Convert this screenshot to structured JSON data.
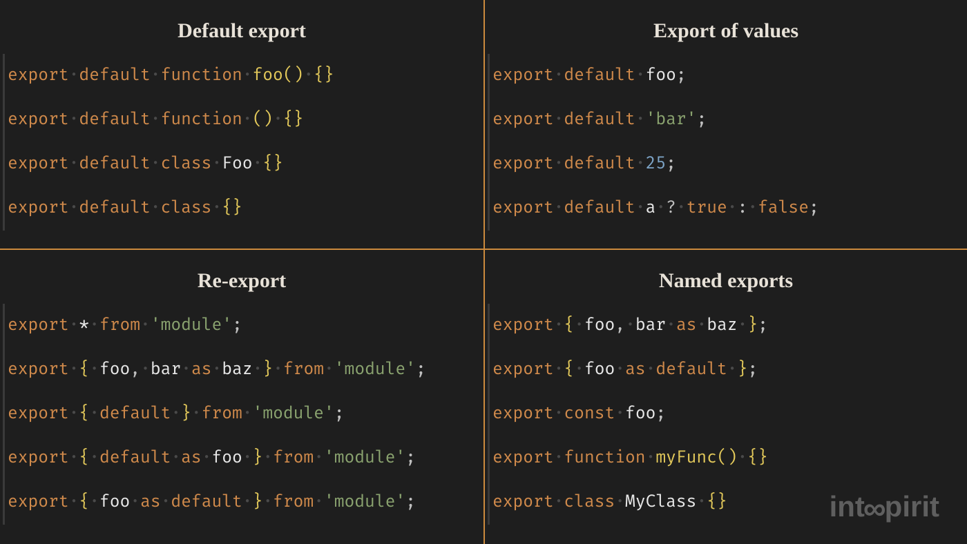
{
  "colors": {
    "divider": "#cc8a3d",
    "bg": "#1e1e1e"
  },
  "logo": {
    "left": "int",
    "symbol": "∞",
    "right": "pirit"
  },
  "quadrants": [
    {
      "id": "default-export",
      "title": "Default export",
      "lines": [
        [
          {
            "t": "export",
            "c": "kw"
          },
          "·",
          {
            "t": "default",
            "c": "kw"
          },
          "·",
          {
            "t": "function",
            "c": "kw"
          },
          "·",
          {
            "t": "foo",
            "c": "fn"
          },
          {
            "t": "()",
            "c": "br"
          },
          "·",
          {
            "t": "{}",
            "c": "br"
          }
        ],
        [
          {
            "t": "export",
            "c": "kw"
          },
          "·",
          {
            "t": "default",
            "c": "kw"
          },
          "·",
          {
            "t": "function",
            "c": "kw"
          },
          "·",
          {
            "t": "()",
            "c": "br"
          },
          "·",
          {
            "t": "{}",
            "c": "br"
          }
        ],
        [
          {
            "t": "export",
            "c": "kw"
          },
          "·",
          {
            "t": "default",
            "c": "kw"
          },
          "·",
          {
            "t": "class",
            "c": "kw"
          },
          "·",
          {
            "t": "Foo",
            "c": "id"
          },
          "·",
          {
            "t": "{}",
            "c": "br"
          }
        ],
        [
          {
            "t": "export",
            "c": "kw"
          },
          "·",
          {
            "t": "default",
            "c": "kw"
          },
          "·",
          {
            "t": "class",
            "c": "kw"
          },
          "·",
          {
            "t": "{}",
            "c": "br"
          }
        ]
      ]
    },
    {
      "id": "export-of-values",
      "title": "Export of values",
      "lines": [
        [
          {
            "t": "export",
            "c": "kw"
          },
          "·",
          {
            "t": "default",
            "c": "kw"
          },
          "·",
          {
            "t": "foo",
            "c": "id"
          },
          {
            "t": ";",
            "c": "pn"
          }
        ],
        [
          {
            "t": "export",
            "c": "kw"
          },
          "·",
          {
            "t": "default",
            "c": "kw"
          },
          "·",
          {
            "t": "'bar'",
            "c": "str"
          },
          {
            "t": ";",
            "c": "pn"
          }
        ],
        [
          {
            "t": "export",
            "c": "kw"
          },
          "·",
          {
            "t": "default",
            "c": "kw"
          },
          "·",
          {
            "t": "25",
            "c": "num"
          },
          {
            "t": ";",
            "c": "pn"
          }
        ],
        [
          {
            "t": "export",
            "c": "kw"
          },
          "·",
          {
            "t": "default",
            "c": "kw"
          },
          "·",
          {
            "t": "a",
            "c": "id"
          },
          "·",
          {
            "t": "?",
            "c": "pn"
          },
          "·",
          {
            "t": "true",
            "c": "kw"
          },
          "·",
          {
            "t": ":",
            "c": "pn"
          },
          "·",
          {
            "t": "false",
            "c": "kw"
          },
          {
            "t": ";",
            "c": "pn"
          }
        ]
      ]
    },
    {
      "id": "re-export",
      "title": "Re-export",
      "lines": [
        [
          {
            "t": "export",
            "c": "kw"
          },
          "·",
          {
            "t": "*",
            "c": "id"
          },
          "·",
          {
            "t": "from",
            "c": "kw"
          },
          "·",
          {
            "t": "'module'",
            "c": "str"
          },
          {
            "t": ";",
            "c": "pn"
          }
        ],
        [
          {
            "t": "export",
            "c": "kw"
          },
          "·",
          {
            "t": "{",
            "c": "br"
          },
          "·",
          {
            "t": "foo",
            "c": "id"
          },
          {
            "t": ",",
            "c": "pn"
          },
          "·",
          {
            "t": "bar",
            "c": "id"
          },
          "·",
          {
            "t": "as",
            "c": "kw"
          },
          "·",
          {
            "t": "baz",
            "c": "id"
          },
          "·",
          {
            "t": "}",
            "c": "br"
          },
          "·",
          {
            "t": "from",
            "c": "kw"
          },
          "·",
          {
            "t": "'module'",
            "c": "str"
          },
          {
            "t": ";",
            "c": "pn"
          }
        ],
        [
          {
            "t": "export",
            "c": "kw"
          },
          "·",
          {
            "t": "{",
            "c": "br"
          },
          "·",
          {
            "t": "default",
            "c": "kw"
          },
          "·",
          {
            "t": "}",
            "c": "br"
          },
          "·",
          {
            "t": "from",
            "c": "kw"
          },
          "·",
          {
            "t": "'module'",
            "c": "str"
          },
          {
            "t": ";",
            "c": "pn"
          }
        ],
        [
          {
            "t": "export",
            "c": "kw"
          },
          "·",
          {
            "t": "{",
            "c": "br"
          },
          "·",
          {
            "t": "default",
            "c": "kw"
          },
          "·",
          {
            "t": "as",
            "c": "kw"
          },
          "·",
          {
            "t": "foo",
            "c": "id"
          },
          "·",
          {
            "t": "}",
            "c": "br"
          },
          "·",
          {
            "t": "from",
            "c": "kw"
          },
          "·",
          {
            "t": "'module'",
            "c": "str"
          },
          {
            "t": ";",
            "c": "pn"
          }
        ],
        [
          {
            "t": "export",
            "c": "kw"
          },
          "·",
          {
            "t": "{",
            "c": "br"
          },
          "·",
          {
            "t": "foo",
            "c": "id"
          },
          "·",
          {
            "t": "as",
            "c": "kw"
          },
          "·",
          {
            "t": "default",
            "c": "kw"
          },
          "·",
          {
            "t": "}",
            "c": "br"
          },
          "·",
          {
            "t": "from",
            "c": "kw"
          },
          "·",
          {
            "t": "'module'",
            "c": "str"
          },
          {
            "t": ";",
            "c": "pn"
          }
        ]
      ]
    },
    {
      "id": "named-exports",
      "title": "Named exports",
      "lines": [
        [
          {
            "t": "export",
            "c": "kw"
          },
          "·",
          {
            "t": "{",
            "c": "br"
          },
          "·",
          {
            "t": "foo",
            "c": "id"
          },
          {
            "t": ",",
            "c": "pn"
          },
          "·",
          {
            "t": "bar",
            "c": "id"
          },
          "·",
          {
            "t": "as",
            "c": "kw"
          },
          "·",
          {
            "t": "baz",
            "c": "id"
          },
          "·",
          {
            "t": "}",
            "c": "br"
          },
          {
            "t": ";",
            "c": "pn"
          }
        ],
        [
          {
            "t": "export",
            "c": "kw"
          },
          "·",
          {
            "t": "{",
            "c": "br"
          },
          "·",
          {
            "t": "foo",
            "c": "id"
          },
          "·",
          {
            "t": "as",
            "c": "kw"
          },
          "·",
          {
            "t": "default",
            "c": "kw"
          },
          "·",
          {
            "t": "}",
            "c": "br"
          },
          {
            "t": ";",
            "c": "pn"
          }
        ],
        [
          {
            "t": "export",
            "c": "kw"
          },
          "·",
          {
            "t": "const",
            "c": "kw"
          },
          "·",
          {
            "t": "foo",
            "c": "id"
          },
          {
            "t": ";",
            "c": "pn"
          }
        ],
        [
          {
            "t": "export",
            "c": "kw"
          },
          "·",
          {
            "t": "function",
            "c": "kw"
          },
          "·",
          {
            "t": "myFunc",
            "c": "fn"
          },
          {
            "t": "()",
            "c": "br"
          },
          "·",
          {
            "t": "{}",
            "c": "br"
          }
        ],
        [
          {
            "t": "export",
            "c": "kw"
          },
          "·",
          {
            "t": "class",
            "c": "kw"
          },
          "·",
          {
            "t": "MyClass",
            "c": "id"
          },
          "·",
          {
            "t": "{}",
            "c": "br"
          }
        ]
      ]
    }
  ]
}
